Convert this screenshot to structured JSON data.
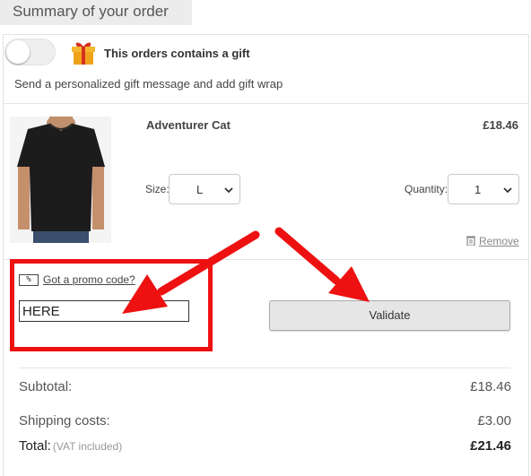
{
  "header": {
    "title": "Summary of your order"
  },
  "gift": {
    "toggle_on": false,
    "title": "This orders contains a gift",
    "description": "Send a personalized gift message and add gift wrap"
  },
  "product": {
    "name": "Adventurer Cat",
    "price": "£18.46",
    "size_label": "Size:",
    "size_value": "L",
    "quantity_label": "Quantity:",
    "quantity_value": "1",
    "remove_label": "Remove"
  },
  "promo": {
    "icon_text": "%",
    "link_label": "Got a promo code?",
    "input_value": "HERE",
    "validate_label": "Validate"
  },
  "summary": {
    "subtotal_label": "Subtotal:",
    "subtotal_value": "£18.46",
    "shipping_label": "Shipping costs:",
    "shipping_value": "£3.00",
    "total_label": "Total:",
    "vat_note": "(VAT included)",
    "total_value": "£21.46"
  },
  "colors": {
    "annotation_red": "#ee1111",
    "button_bg": "#e6e6e6"
  }
}
